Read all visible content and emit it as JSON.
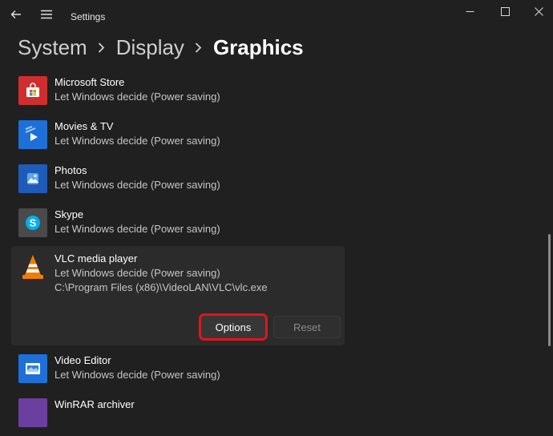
{
  "window": {
    "title": "Settings"
  },
  "breadcrumb": {
    "items": [
      "System",
      "Display",
      "Graphics"
    ]
  },
  "apps": [
    {
      "name": "Microsoft Store",
      "sub": "Let Windows decide (Power saving)",
      "icon": "microsoft-store-icon",
      "color": "#d02e2e"
    },
    {
      "name": "Movies & TV",
      "sub": "Let Windows decide (Power saving)",
      "icon": "movies-tv-icon",
      "color": "#1e6fd8"
    },
    {
      "name": "Photos",
      "sub": "Let Windows decide (Power saving)",
      "icon": "photos-icon",
      "color": "#1f5bb8"
    },
    {
      "name": "Skype",
      "sub": "Let Windows decide (Power saving)",
      "icon": "skype-icon",
      "color": "#4a4a4a"
    },
    {
      "name": "VLC media player",
      "sub": "Let Windows decide (Power saving)",
      "path": "C:\\Program Files (x86)\\VideoLAN\\VLC\\vlc.exe",
      "icon": "vlc-icon",
      "color": "#e65c00"
    },
    {
      "name": "Video Editor",
      "sub": "Let Windows decide (Power saving)",
      "icon": "video-editor-icon",
      "color": "#1e6fd8"
    },
    {
      "name": "WinRAR archiver",
      "icon": "winrar-icon"
    }
  ],
  "actions": {
    "options_label": "Options",
    "reset_label": "Reset"
  },
  "colors": {
    "background": "#202020",
    "highlight": "#e3141b"
  }
}
